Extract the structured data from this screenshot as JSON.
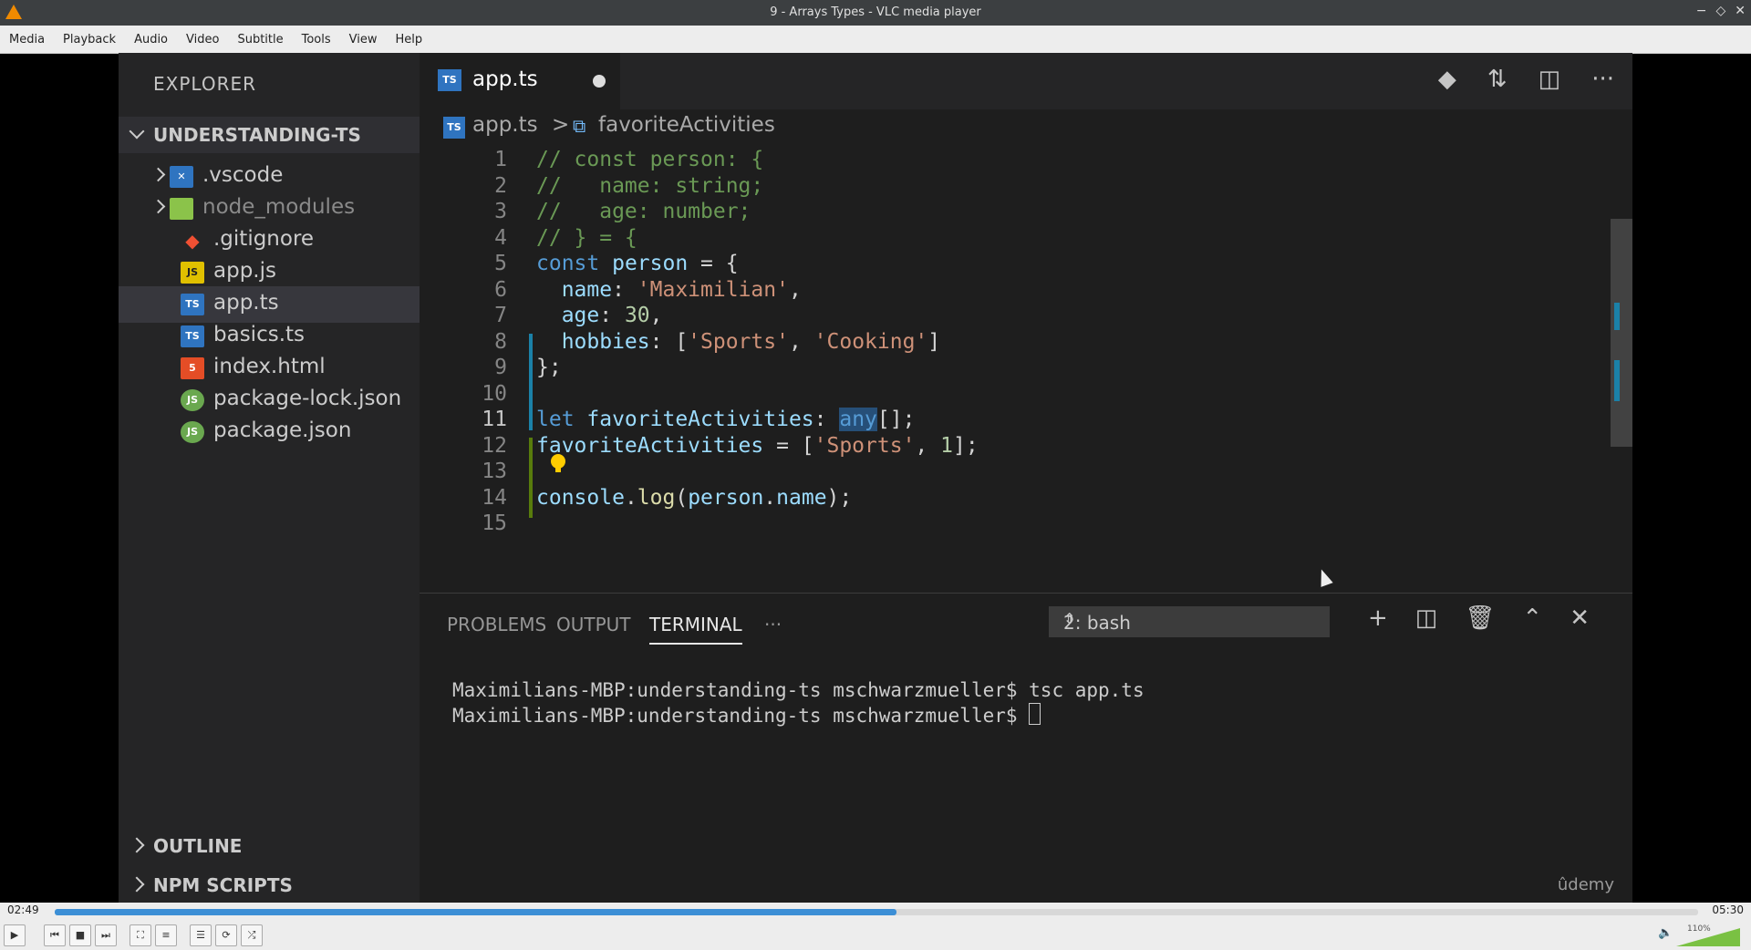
{
  "window": {
    "title": "9 - Arrays Types - VLC media player",
    "controls": [
      "−",
      "◇",
      "✕"
    ]
  },
  "menu": [
    "Media",
    "Playback",
    "Audio",
    "Video",
    "Subtitle",
    "Tools",
    "View",
    "Help"
  ],
  "sidebar": {
    "explorer_label": "EXPLORER",
    "project": "UNDERSTANDING-TS",
    "files": [
      {
        "name": ".vscode",
        "icon": "folder-vscode-icon",
        "badge": "✕",
        "expandable": true
      },
      {
        "name": "node_modules",
        "icon": "folder-node-icon",
        "badge": "",
        "expandable": true
      },
      {
        "name": ".gitignore",
        "icon": "git-icon",
        "badge": "◆"
      },
      {
        "name": "app.js",
        "icon": "js-icon",
        "badge": "JS"
      },
      {
        "name": "app.ts",
        "icon": "ts-icon",
        "badge": "TS"
      },
      {
        "name": "basics.ts",
        "icon": "ts-icon",
        "badge": "TS"
      },
      {
        "name": "index.html",
        "icon": "html-icon",
        "badge": "5"
      },
      {
        "name": "package-lock.json",
        "icon": "npm-icon",
        "badge": "JS"
      },
      {
        "name": "package.json",
        "icon": "npm-icon",
        "badge": "JS"
      }
    ],
    "sections": [
      "OUTLINE",
      "NPM SCRIPTS"
    ]
  },
  "editor": {
    "tab": "app.ts",
    "tab_badge": "TS",
    "breadcrumb": {
      "file": "app.ts",
      "separator": ">",
      "symbol": "favoriteActivities"
    },
    "lines": [
      "1",
      "2",
      "3",
      "4",
      "5",
      "6",
      "7",
      "8",
      "9",
      "10",
      "11",
      "12",
      "13",
      "14",
      "15"
    ],
    "code": [
      [
        {
          "t": "// const person: {",
          "c": "c"
        }
      ],
      [
        {
          "t": "//   name: string;",
          "c": "c"
        }
      ],
      [
        {
          "t": "//   age: number;",
          "c": "c"
        }
      ],
      [
        {
          "t": "// } = {",
          "c": "c"
        }
      ],
      [
        {
          "t": "const ",
          "c": "k"
        },
        {
          "t": "person",
          "c": "v"
        },
        {
          "t": " = {",
          "c": ""
        }
      ],
      [
        {
          "t": "  name",
          "c": "v"
        },
        {
          "t": ": ",
          "c": ""
        },
        {
          "t": "'Maximilian'",
          "c": "s"
        },
        {
          "t": ",",
          "c": ""
        }
      ],
      [
        {
          "t": "  age",
          "c": "v"
        },
        {
          "t": ": ",
          "c": ""
        },
        {
          "t": "30",
          "c": "n"
        },
        {
          "t": ",",
          "c": ""
        }
      ],
      [
        {
          "t": "  hobbies",
          "c": "v"
        },
        {
          "t": ": [",
          "c": ""
        },
        {
          "t": "'Sports'",
          "c": "s"
        },
        {
          "t": ", ",
          "c": ""
        },
        {
          "t": "'Cooking'",
          "c": "s"
        },
        {
          "t": "]",
          "c": ""
        }
      ],
      [
        {
          "t": "};",
          "c": ""
        }
      ],
      [],
      [
        {
          "t": "let ",
          "c": "k"
        },
        {
          "t": "favoriteActivities",
          "c": "v"
        },
        {
          "t": ": ",
          "c": ""
        },
        {
          "t": "any",
          "c": "k hl"
        },
        {
          "t": "[];",
          "c": ""
        }
      ],
      [
        {
          "t": "favoriteActivities",
          "c": "v"
        },
        {
          "t": " = [",
          "c": ""
        },
        {
          "t": "'Sports'",
          "c": "s"
        },
        {
          "t": ", ",
          "c": ""
        },
        {
          "t": "1",
          "c": "n"
        },
        {
          "t": "];",
          "c": ""
        }
      ],
      [],
      [
        {
          "t": "console",
          "c": "v"
        },
        {
          "t": ".",
          "c": ""
        },
        {
          "t": "log",
          "c": "f"
        },
        {
          "t": "(",
          "c": ""
        },
        {
          "t": "person",
          "c": "v"
        },
        {
          "t": ".",
          "c": ""
        },
        {
          "t": "name",
          "c": "v"
        },
        {
          "t": ");",
          "c": ""
        }
      ],
      []
    ],
    "current_line": 11
  },
  "panel": {
    "tabs": [
      "PROBLEMS",
      "OUTPUT",
      "TERMINAL",
      "···"
    ],
    "active_tab": "TERMINAL",
    "shell": "2: bash",
    "terminal_lines": [
      "Maximilians-MBP:understanding-ts mschwarzmueller$ tsc app.ts",
      "Maximilians-MBP:understanding-ts mschwarzmueller$ "
    ],
    "watermark": "ûdemy"
  },
  "player": {
    "elapsed": "02:49",
    "total": "05:30",
    "progress": 0.512,
    "volume_label": "110%",
    "volume": 1.1
  }
}
